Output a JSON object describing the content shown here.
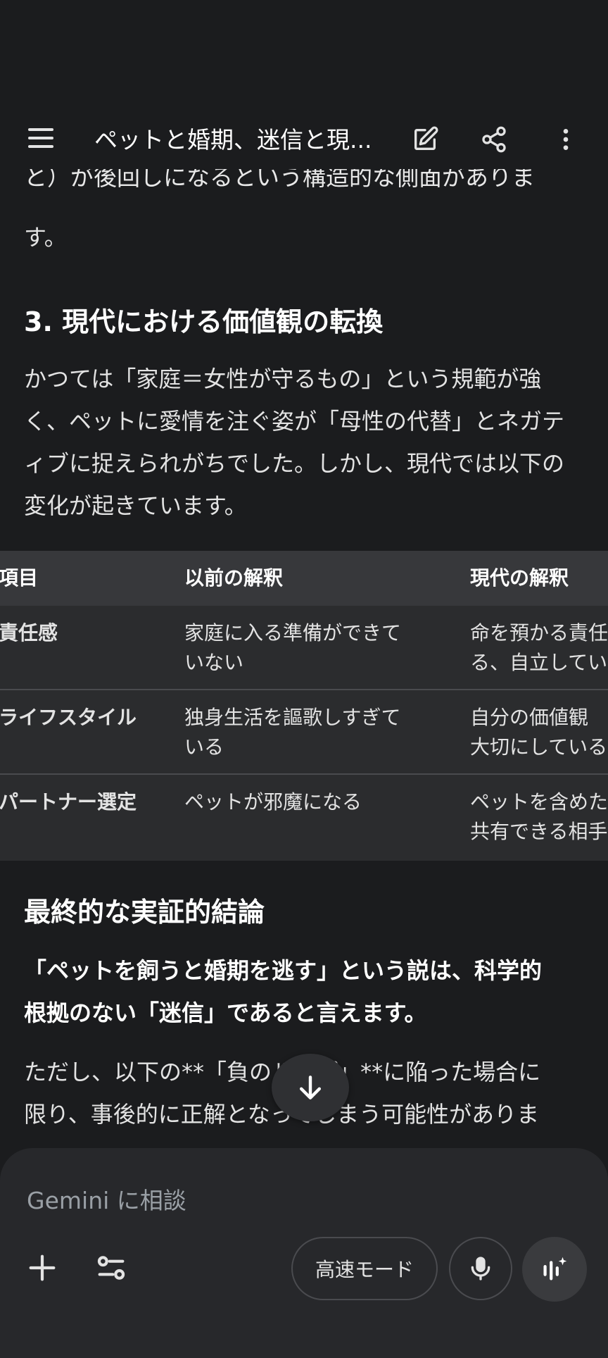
{
  "header": {
    "title": "ペットと婚期、迷信と現..."
  },
  "content": {
    "clipped_line": "と）が後回しになるという構造的な側面がありま",
    "para_end": "す。",
    "section3_heading": "3. 現代における価値観の転換",
    "section3_paragraph": "かつては「家庭＝女性が守るもの」という規範が強く、ペットに愛情を注ぐ姿が「母性の代替」とネガティブに捉えられがちでした。しかし、現代では以下の変化が起きています。",
    "table": {
      "headers": [
        "項目",
        "以前の解釈",
        "現代の解釈"
      ],
      "rows": [
        {
          "item": "責任感",
          "before": [
            "家庭に入る準備ができて",
            "いない"
          ],
          "now": [
            "命を預かる責任",
            "る、自立してい"
          ]
        },
        {
          "item": "ライフスタイル",
          "before": [
            "独身生活を謳歌しすぎて",
            "いる"
          ],
          "now": [
            "自分の価値観",
            "大切にしている"
          ]
        },
        {
          "item": "パートナー選定",
          "before": [
            "ペットが邪魔になる"
          ],
          "now": [
            "ペットを含めた",
            "共有できる相手"
          ]
        }
      ]
    },
    "conclusion_heading": "最終的な実証的結論",
    "conclusion_bold": [
      "「ペットを飼うと婚期を逃す」という説は、科学的",
      "根拠のない「迷信」であると言えます。"
    ],
    "conclusion_para": [
      "ただし、以下の**「負のループ」**に陥った場合に",
      "限り、事後的に正解となってしまう可能性がありま"
    ]
  },
  "composer": {
    "placeholder": "Gemini に相談",
    "mode_label": "高速モード"
  },
  "colors": {
    "background": "#1b1c1e",
    "table_header": "#37383b",
    "table_body": "#2b2c2e",
    "composer": "#27282b"
  }
}
